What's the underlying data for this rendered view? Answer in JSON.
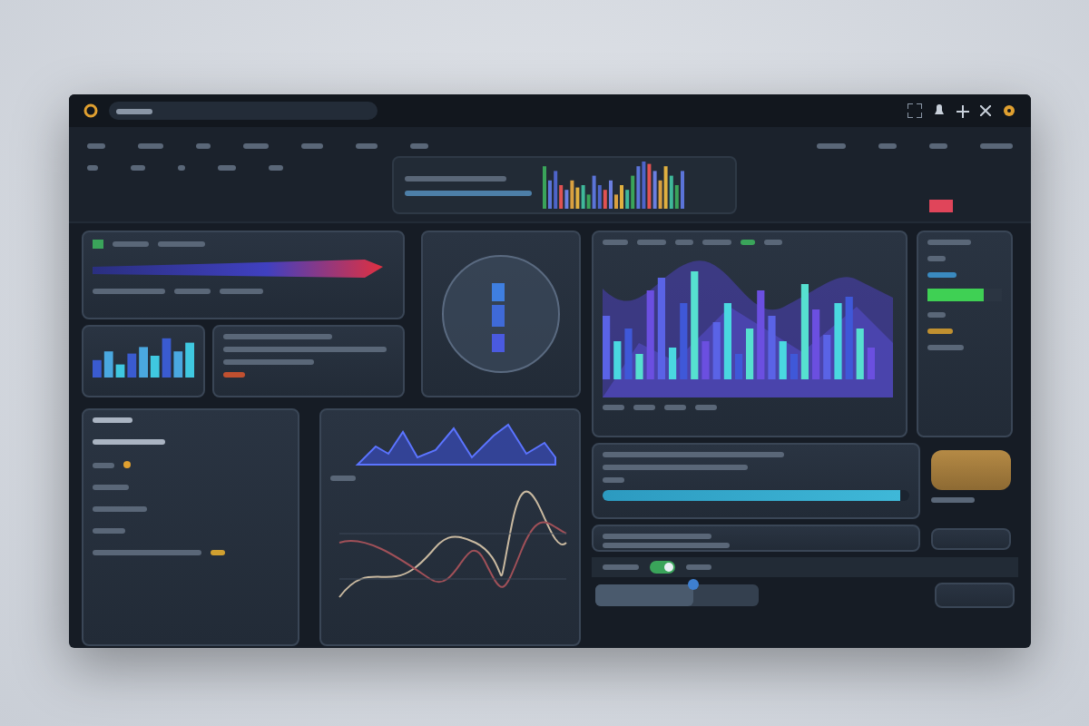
{
  "progress_bar": {
    "level": 0.97
  },
  "slider": {
    "level": 0.6
  },
  "toggle": {
    "on": true
  },
  "side_meter": {
    "level": 0.75
  }
}
